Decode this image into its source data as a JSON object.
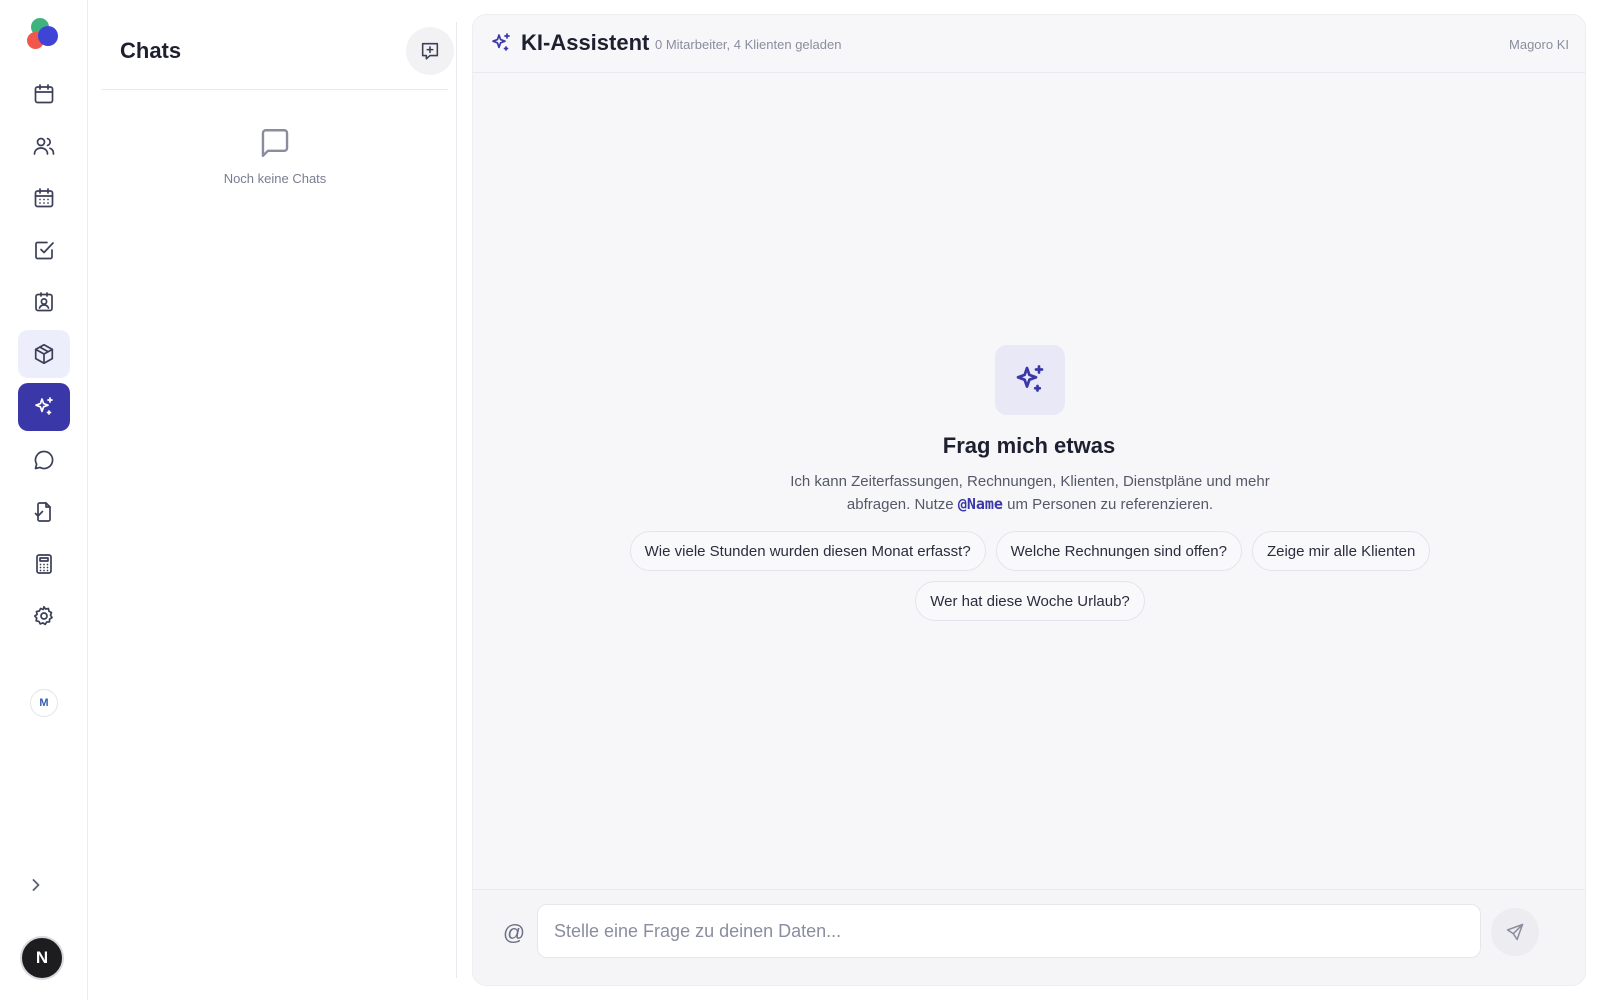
{
  "sidebar": {
    "nav": [
      {
        "icon": "calendar-icon"
      },
      {
        "icon": "users-icon"
      },
      {
        "icon": "schedule-icon"
      },
      {
        "icon": "checkbox-icon"
      },
      {
        "icon": "contact-card-icon"
      },
      {
        "icon": "package-icon"
      },
      {
        "icon": "sparkles-icon",
        "active": true
      },
      {
        "icon": "message-icon"
      },
      {
        "icon": "document-check-icon"
      },
      {
        "icon": "calculator-icon"
      },
      {
        "icon": "gear-icon"
      }
    ],
    "workspace_initial": "M",
    "user_initial": "N"
  },
  "chats": {
    "title": "Chats",
    "empty_text": "Noch keine Chats"
  },
  "main": {
    "title": "KI-Assistent",
    "subtitle": "0 Mitarbeiter, 4 Klienten geladen",
    "brand": "Magoro KI",
    "hero": {
      "title": "Frag mich etwas",
      "desc_before": "Ich kann Zeiterfassungen, Rechnungen, Klienten, Dienstpläne und mehr abfragen. Nutze ",
      "mention": "@Name",
      "desc_after": " um Personen zu referenzieren."
    },
    "suggestions": [
      "Wie viele Stunden wurden diesen Monat erfasst?",
      "Welche Rechnungen sind offen?",
      "Zeige mir alle Klienten",
      "Wer hat diese Woche Urlaub?"
    ],
    "input": {
      "at_symbol": "@",
      "placeholder": "Stelle eine Frage zu deinen Daten...",
      "value": ""
    }
  },
  "colors": {
    "accent": "#3a38a8",
    "accent_soft": "#e8e8f7"
  }
}
